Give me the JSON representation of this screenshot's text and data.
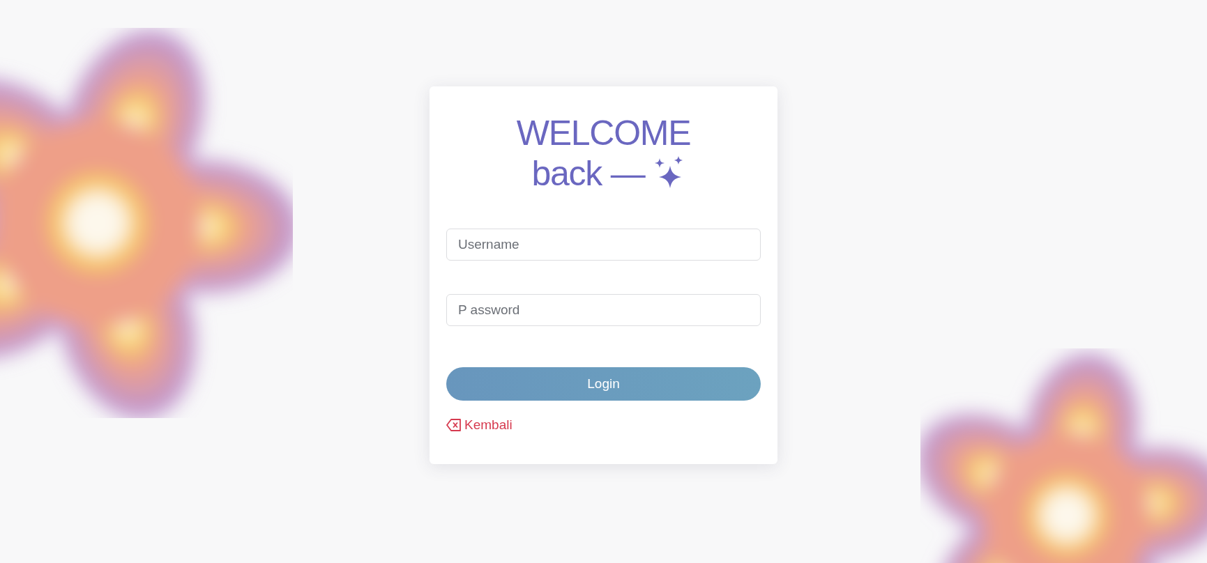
{
  "heading": {
    "line_1": "WELCOME",
    "line_2": "back —"
  },
  "fields": [
    {
      "placeholder": "Username"
    },
    {
      "placeholder": "P assword"
    }
  ],
  "login_button": "Login",
  "back_link": "Kembali"
}
